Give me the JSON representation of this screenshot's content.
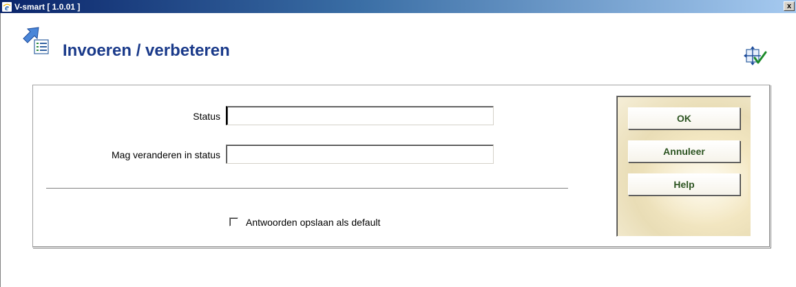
{
  "window": {
    "title": "V-smart [ 1.0.01 ]",
    "close_label": "x"
  },
  "page": {
    "title": "Invoeren / verbeteren"
  },
  "form": {
    "status_label": "Status",
    "status_value": "",
    "mag_veranderen_label": "Mag veranderen in status",
    "mag_veranderen_value": "",
    "checkbox_label": "Antwoorden opslaan als default",
    "checkbox_checked": false
  },
  "buttons": {
    "ok": "OK",
    "annuleer": "Annuleer",
    "help": "Help"
  },
  "icons": {
    "app": "ie-icon",
    "header": "edit-list-icon",
    "top_right": "expand-check-icon",
    "close": "close-icon"
  },
  "colors": {
    "title_blue": "#1a3a8a",
    "button_text_green": "#2b5320",
    "titlebar_start": "#0a246a",
    "titlebar_end": "#a6caf0"
  }
}
